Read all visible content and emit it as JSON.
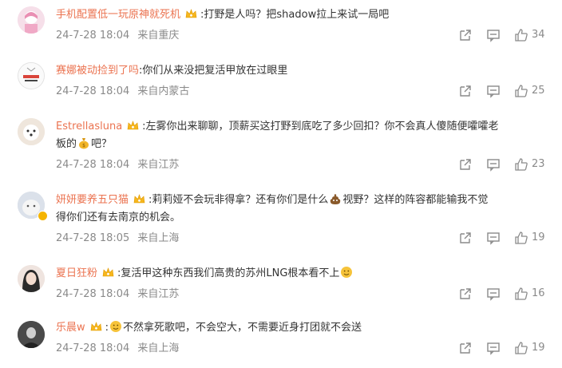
{
  "comments": [
    {
      "username": "手机配置低一玩原神就死机",
      "text": ":打野是人吗？把shadow拉上来试一局吧",
      "date": "24-7-28 18:04",
      "location": "来自重庆",
      "likes": "34"
    },
    {
      "username": "赛娜被动捡到了吗",
      "text": ":你们从来没把复活甲放在过眼里",
      "date": "24-7-28 18:04",
      "location": "来自内蒙古",
      "likes": "25"
    },
    {
      "username": "Estrellasluna",
      "text": ":左雾你出来聊聊，顶薪买这打野到底吃了多少回扣？你不会真人傻随便嚯嚯老",
      "text2a": "板的",
      "text2b": "吧？",
      "date": "24-7-28 18:04",
      "location": "来自江苏",
      "likes": "23"
    },
    {
      "username": "妍妍要养五只猫",
      "text1a": ":莉莉娅不会玩非得拿？还有你们是什么",
      "text1b": "视野？这样的阵容都能输我不觉",
      "text2": "得你们还有去南京的机会。",
      "date": "24-7-28 18:05",
      "location": "来自上海",
      "likes": "19"
    },
    {
      "username": "夏日狂粉",
      "text": ":复活甲这种东西我们高贵的苏州LNG根本看不上",
      "date": "24-7-28 18:04",
      "location": "来自江苏",
      "likes": "16"
    },
    {
      "username": "乐晨w",
      "text_a": ":",
      "text_b": "不然拿死歌吧，不会空大，不需要近身打团就不会送",
      "date": "24-7-28 18:04",
      "location": "来自上海",
      "likes": "19"
    }
  ],
  "icons": {
    "share": "share-icon",
    "comment": "comment-icon",
    "like": "thumbs-up-icon",
    "crown": "crown-badge-icon",
    "moneybag": "money-bag-emoji",
    "poop": "poop-emoji",
    "smile": "smiling-face-emoji"
  },
  "colors": {
    "username": "#eb7350",
    "meta": "#8a8a8a",
    "text": "#333333"
  }
}
